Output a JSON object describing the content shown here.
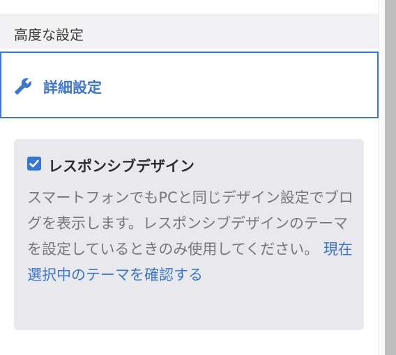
{
  "section": {
    "title": "高度な設定"
  },
  "advanced": {
    "label": "詳細設定",
    "icon": "wrench-icon",
    "accent": "#3d77cc"
  },
  "responsive": {
    "checkbox_label": "レスポンシブデザイン",
    "checked": true,
    "description": "スマートフォンでもPCと同じデザイン設定でブログを表示します。レスポンシブデザインのテーマを設定しているときのみ使用してください。",
    "link": "現在選択中のテーマを確認する"
  }
}
